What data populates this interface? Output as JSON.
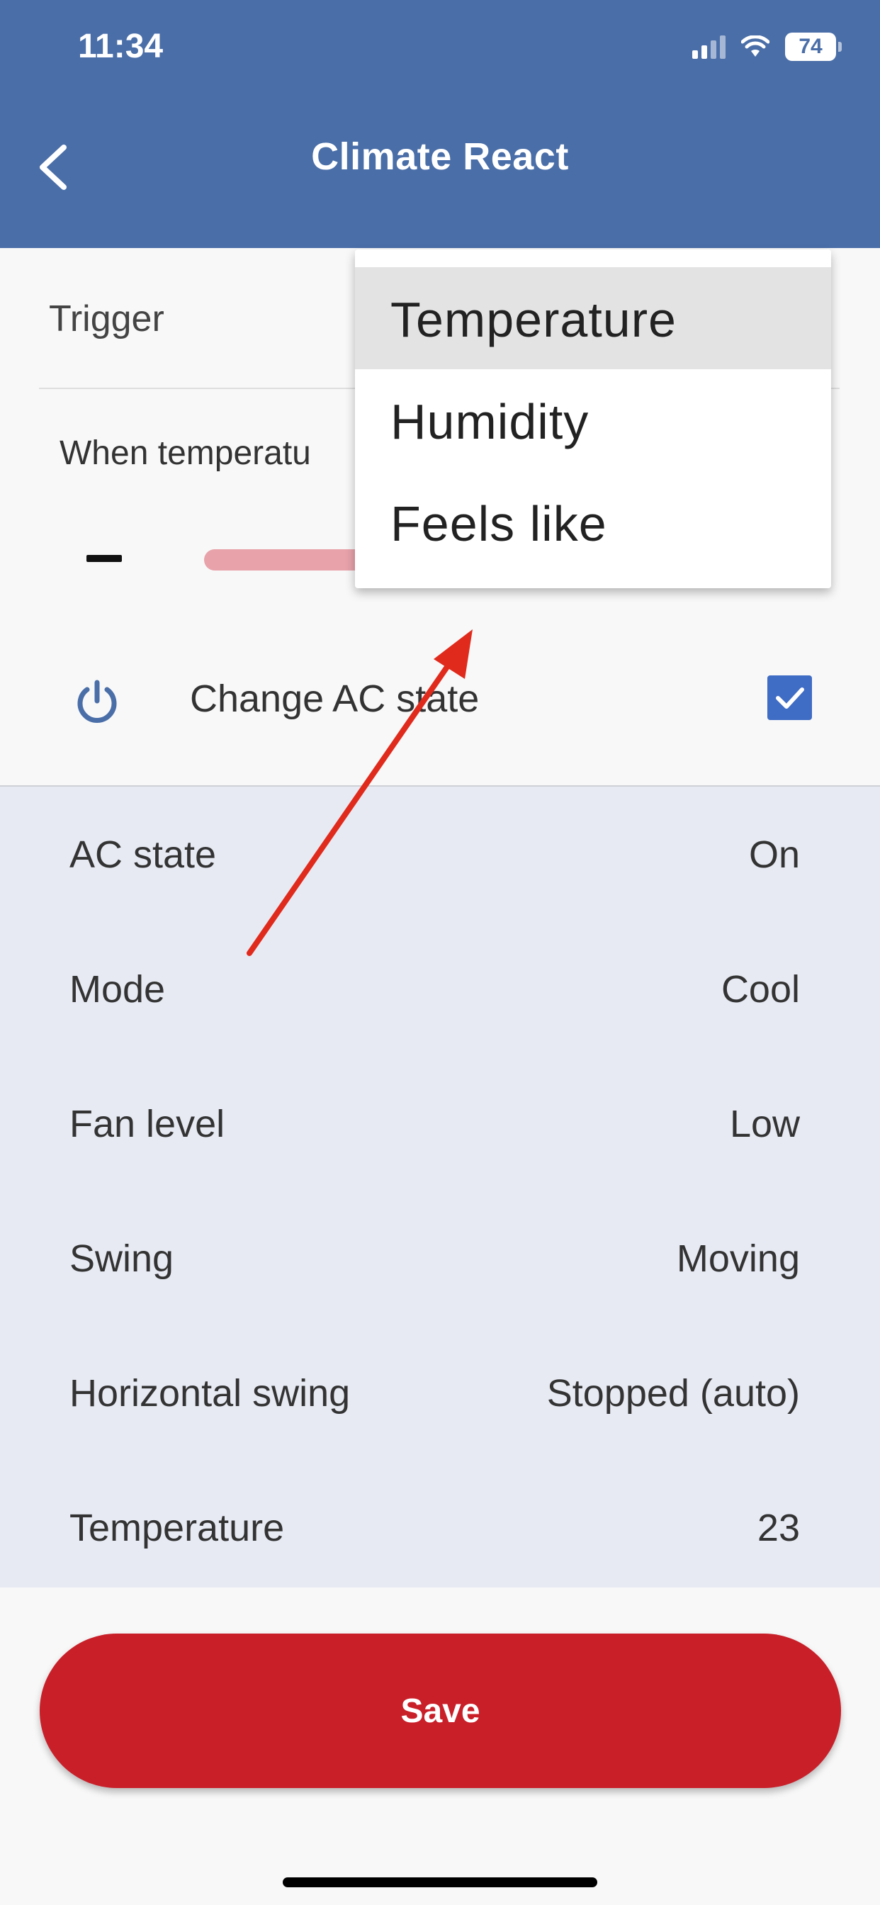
{
  "status_bar": {
    "time": "11:34",
    "battery": "74"
  },
  "header": {
    "title": "Climate React"
  },
  "trigger": {
    "label": "Trigger"
  },
  "condition": {
    "text": "When temperatu"
  },
  "change_ac": {
    "label": "Change AC state",
    "checked": true
  },
  "ac_settings": [
    {
      "label": "AC state",
      "value": "On"
    },
    {
      "label": "Mode",
      "value": "Cool"
    },
    {
      "label": "Fan level",
      "value": "Low"
    },
    {
      "label": "Swing",
      "value": "Moving"
    },
    {
      "label": "Horizontal swing",
      "value": "Stopped (auto)"
    },
    {
      "label": "Temperature",
      "value": "23"
    }
  ],
  "dropdown": {
    "options": [
      "Temperature",
      "Humidity",
      "Feels like"
    ],
    "selected": "Temperature"
  },
  "save_button": {
    "label": "Save"
  },
  "colors": {
    "header": "#4a6ea8",
    "save": "#c91f29",
    "checkbox": "#3f6cc4",
    "panel": "#e7eaf3",
    "slider": "#e8a2aa",
    "annotation_arrow": "#e02a1c"
  },
  "icons": [
    "back-chevron-icon",
    "signal-icon",
    "wifi-icon",
    "battery-icon",
    "power-icon",
    "checkmark-icon"
  ]
}
